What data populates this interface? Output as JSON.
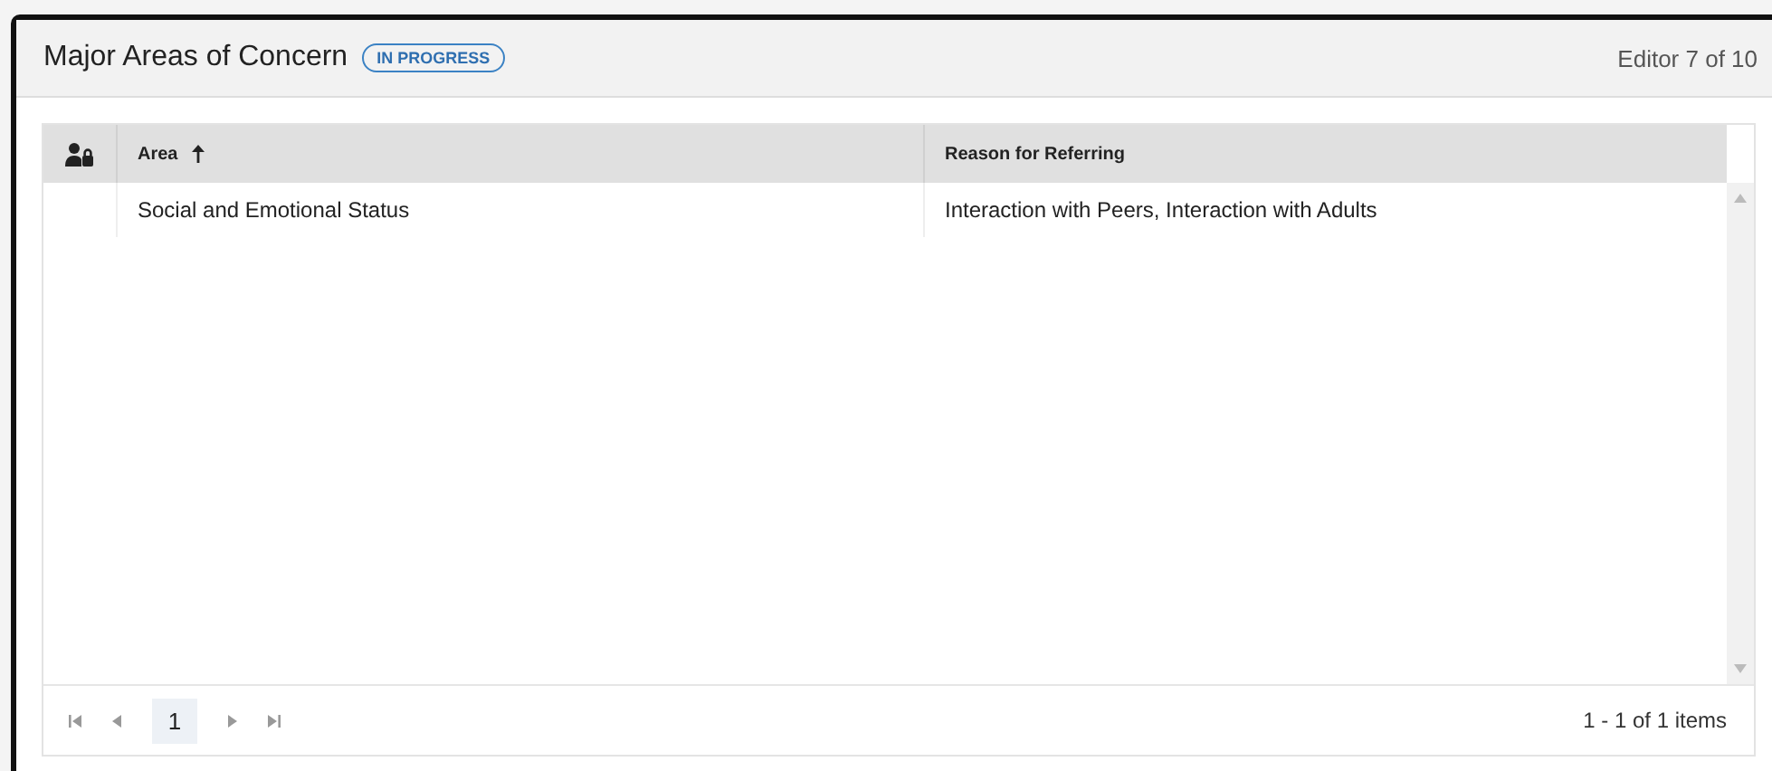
{
  "header": {
    "title": "Major Areas of Concern",
    "status_badge": "IN PROGRESS",
    "editor_position": "Editor 7 of 10"
  },
  "table": {
    "columns": [
      {
        "label": "Area",
        "sorted": true
      },
      {
        "label": "Reason for Referring",
        "sorted": false
      }
    ],
    "rows": [
      {
        "cells": [
          "Social and Emotional Status",
          "Interaction with Peers, Interaction with Adults"
        ]
      }
    ]
  },
  "pager": {
    "pages": [
      {
        "label": "1",
        "selected": true
      }
    ],
    "summary": "1 - 1 of 1 items"
  }
}
